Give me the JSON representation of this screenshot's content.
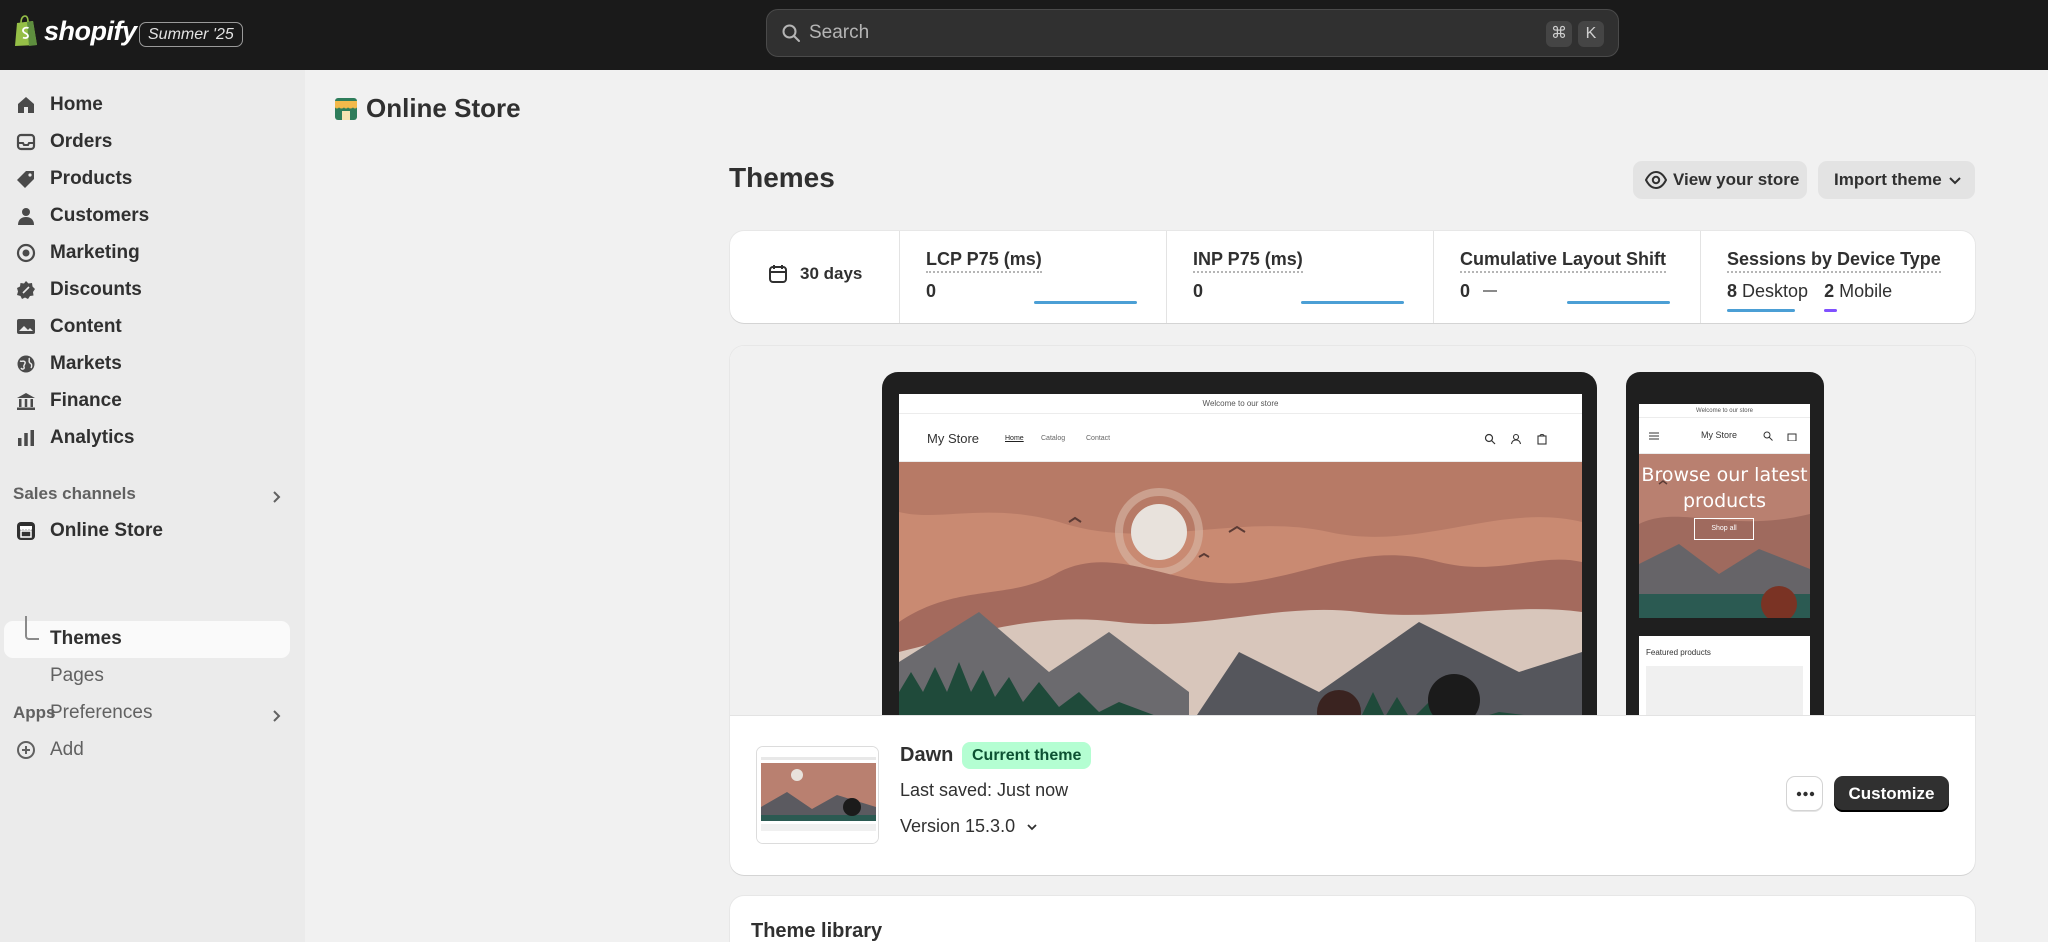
{
  "topbar": {
    "brand": "shopify",
    "edition": "Summer '25",
    "search_placeholder": "Search",
    "shortcut_keys": [
      "⌘",
      "K"
    ]
  },
  "sidebar": {
    "items": [
      {
        "label": "Home",
        "icon": "home-icon"
      },
      {
        "label": "Orders",
        "icon": "inbox-icon"
      },
      {
        "label": "Products",
        "icon": "tag-icon"
      },
      {
        "label": "Customers",
        "icon": "person-icon"
      },
      {
        "label": "Marketing",
        "icon": "target-icon"
      },
      {
        "label": "Discounts",
        "icon": "discount-icon"
      },
      {
        "label": "Content",
        "icon": "image-icon"
      },
      {
        "label": "Markets",
        "icon": "globe-icon"
      },
      {
        "label": "Finance",
        "icon": "bank-icon"
      },
      {
        "label": "Analytics",
        "icon": "chart-icon"
      }
    ],
    "sales_channels_label": "Sales channels",
    "online_store_label": "Online Store",
    "sub_items": [
      "Themes",
      "Pages",
      "Preferences"
    ],
    "apps_label": "Apps",
    "add_label": "Add"
  },
  "page": {
    "heading": "Online Store",
    "title": "Themes",
    "view_store_label": "View your store",
    "import_theme_label": "Import theme"
  },
  "metrics": {
    "period": "30 days",
    "lcp": {
      "title": "LCP P75 (ms)",
      "value": "0"
    },
    "inp": {
      "title": "INP P75 (ms)",
      "value": "0"
    },
    "cls": {
      "title": "Cumulative Layout Shift",
      "value": "0"
    },
    "sessions": {
      "title": "Sessions by Device Type",
      "desktop_count": "8",
      "desktop_label": "Desktop",
      "mobile_count": "2",
      "mobile_label": "Mobile"
    }
  },
  "preview": {
    "announcement": "Welcome to our store",
    "store_name": "My Store",
    "nav": [
      "Home",
      "Catalog",
      "Contact"
    ],
    "phone_hero_text": "Browse our latest products",
    "phone_button": "Shop all",
    "phone_featured": "Featured products"
  },
  "current_theme": {
    "name": "Dawn",
    "badge": "Current theme",
    "last_saved": "Last saved: Just now",
    "version": "Version 15.3.0",
    "customize_label": "Customize"
  },
  "library": {
    "title": "Theme library"
  },
  "colors": {
    "topbar": "#1a1a1a",
    "sidebar": "#ebebeb",
    "badge_bg": "#b4fed2",
    "sparkline": "#4b9fd5",
    "mobile_bar": "#8051ff",
    "primary_button": "#303030"
  }
}
